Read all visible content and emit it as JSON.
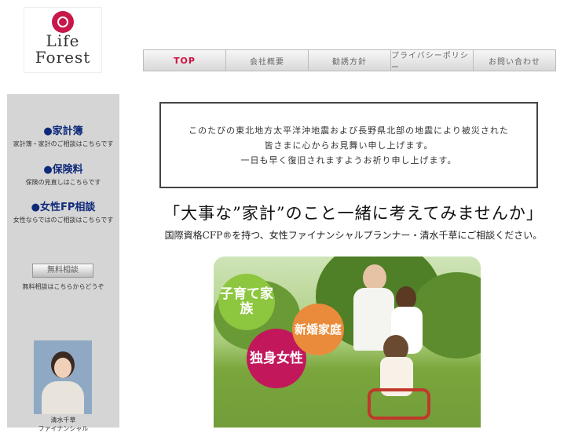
{
  "logo": {
    "line1": "Life",
    "line2": "Forest"
  },
  "nav": [
    {
      "label": "TOP"
    },
    {
      "label": "会社概要"
    },
    {
      "label": "勧誘方針"
    },
    {
      "label": "プライバシーポリシー"
    },
    {
      "label": "お問い合わせ"
    }
  ],
  "sidebar": {
    "links": [
      {
        "title": "●家計簿",
        "desc": "家計簿・家計のご相談はこちらです"
      },
      {
        "title": "●保険料",
        "desc": "保険の見直しはこちらです"
      },
      {
        "title": "●女性FP相談",
        "desc": "女性ならではのご相談はこちらです"
      }
    ],
    "consult_button": "無料相談",
    "consult_desc": "無料相談はこちらからどうぞ",
    "photo_caption_1": "清水千草",
    "photo_caption_2": "ファイナンシャル"
  },
  "notice": {
    "line1": "このたびの東北地方太平洋沖地震および長野県北部の地震により被災された",
    "line2": "皆さまに心からお見舞い申し上げます。",
    "line3": "一日も早く復旧されますようお祈り申し上げます。"
  },
  "headline": "「大事な”家計”のこと一緒に考えてみませんか」",
  "subline": "国際資格CFP®を持つ、女性ファイナンシャルプランナー・清水千草にご相談ください。",
  "hero": {
    "bubble1": "子育て家族",
    "bubble2": "独身女性",
    "bubble3": "新婚家庭"
  },
  "colors": {
    "accent": "#d0103f",
    "link": "#102a7a",
    "sidebar_bg": "#d5d5d5"
  }
}
